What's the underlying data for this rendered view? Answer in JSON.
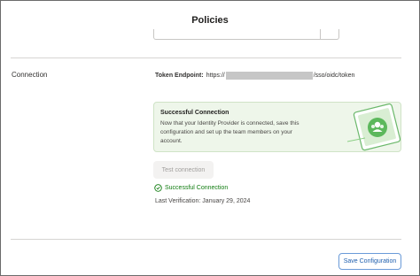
{
  "header": {
    "title": "Policies"
  },
  "connection": {
    "section_label": "Connection",
    "token_endpoint_label": "Token Endpoint:",
    "token_prefix": "https://",
    "token_suffix": "/sso/oidc/token",
    "success_card": {
      "title": "Successful Connection",
      "body": "Now that your Identity Provider is connected, save this configuration and set up the team members on your account."
    },
    "test_button_label": "Test connection",
    "status_text": "Successful Connection",
    "last_verification": "Last Verification: January 29, 2024"
  },
  "footer": {
    "save_label": "Save Configuration"
  },
  "colors": {
    "success_green": "#107c10",
    "card_bg": "#eef6ea",
    "link_blue": "#1f5fae"
  }
}
